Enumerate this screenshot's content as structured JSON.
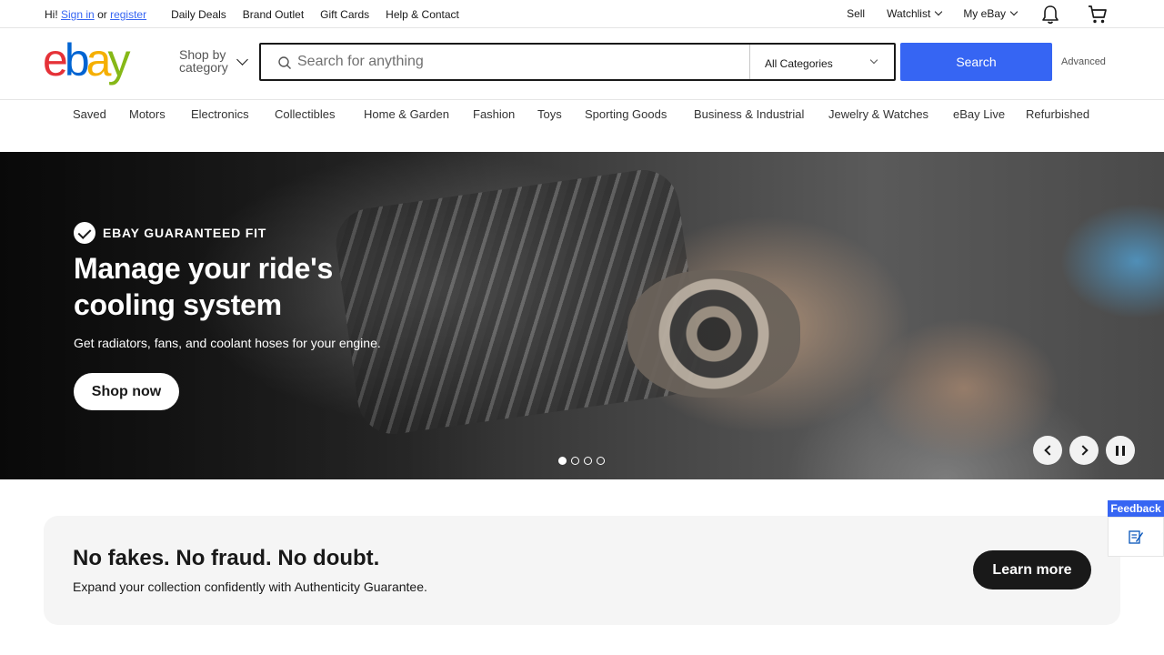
{
  "topbar": {
    "greeting_prefix": "Hi!",
    "sign_in": "Sign in",
    "or": "or",
    "register": "register",
    "links": [
      "Daily Deals",
      "Brand Outlet",
      "Gift Cards",
      "Help & Contact"
    ],
    "sell": "Sell",
    "watchlist": "Watchlist",
    "my_ebay": "My eBay"
  },
  "header": {
    "logo": {
      "e": "e",
      "b": "b",
      "a": "a",
      "y": "y"
    },
    "shop_by_category": [
      "Shop by",
      "category"
    ],
    "search_placeholder": "Search for anything",
    "category_selected": "All Categories",
    "search_button": "Search",
    "advanced": "Advanced"
  },
  "nav": [
    "Saved",
    "Motors",
    "Electronics",
    "Collectibles",
    "Home & Garden",
    "Fashion",
    "Toys",
    "Sporting Goods",
    "Business & Industrial",
    "Jewelry & Watches",
    "eBay Live",
    "Refurbished"
  ],
  "hero": {
    "badge": "EBAY GUARANTEED FIT",
    "title": "Manage your ride's cooling system",
    "subtitle": "Get radiators, fans, and coolant hoses for your engine.",
    "cta": "Shop now",
    "slide_count": 4,
    "active_slide": 1
  },
  "promo": {
    "title": "No fakes. No fraud. No doubt.",
    "text": "Expand your collection confidently with Authenticity Guarantee.",
    "cta": "Learn more"
  },
  "feedback": {
    "label": "Feedback"
  },
  "colors": {
    "accent": "#3665f3",
    "logo_red": "#e53238",
    "logo_blue": "#0064d2",
    "logo_yellow": "#f5af02",
    "logo_green": "#86b817"
  },
  "icons": [
    "search-icon",
    "bell-icon",
    "cart-icon",
    "checkmark-icon",
    "chevron-left-icon",
    "chevron-right-icon",
    "pause-icon",
    "feedback-icon"
  ]
}
